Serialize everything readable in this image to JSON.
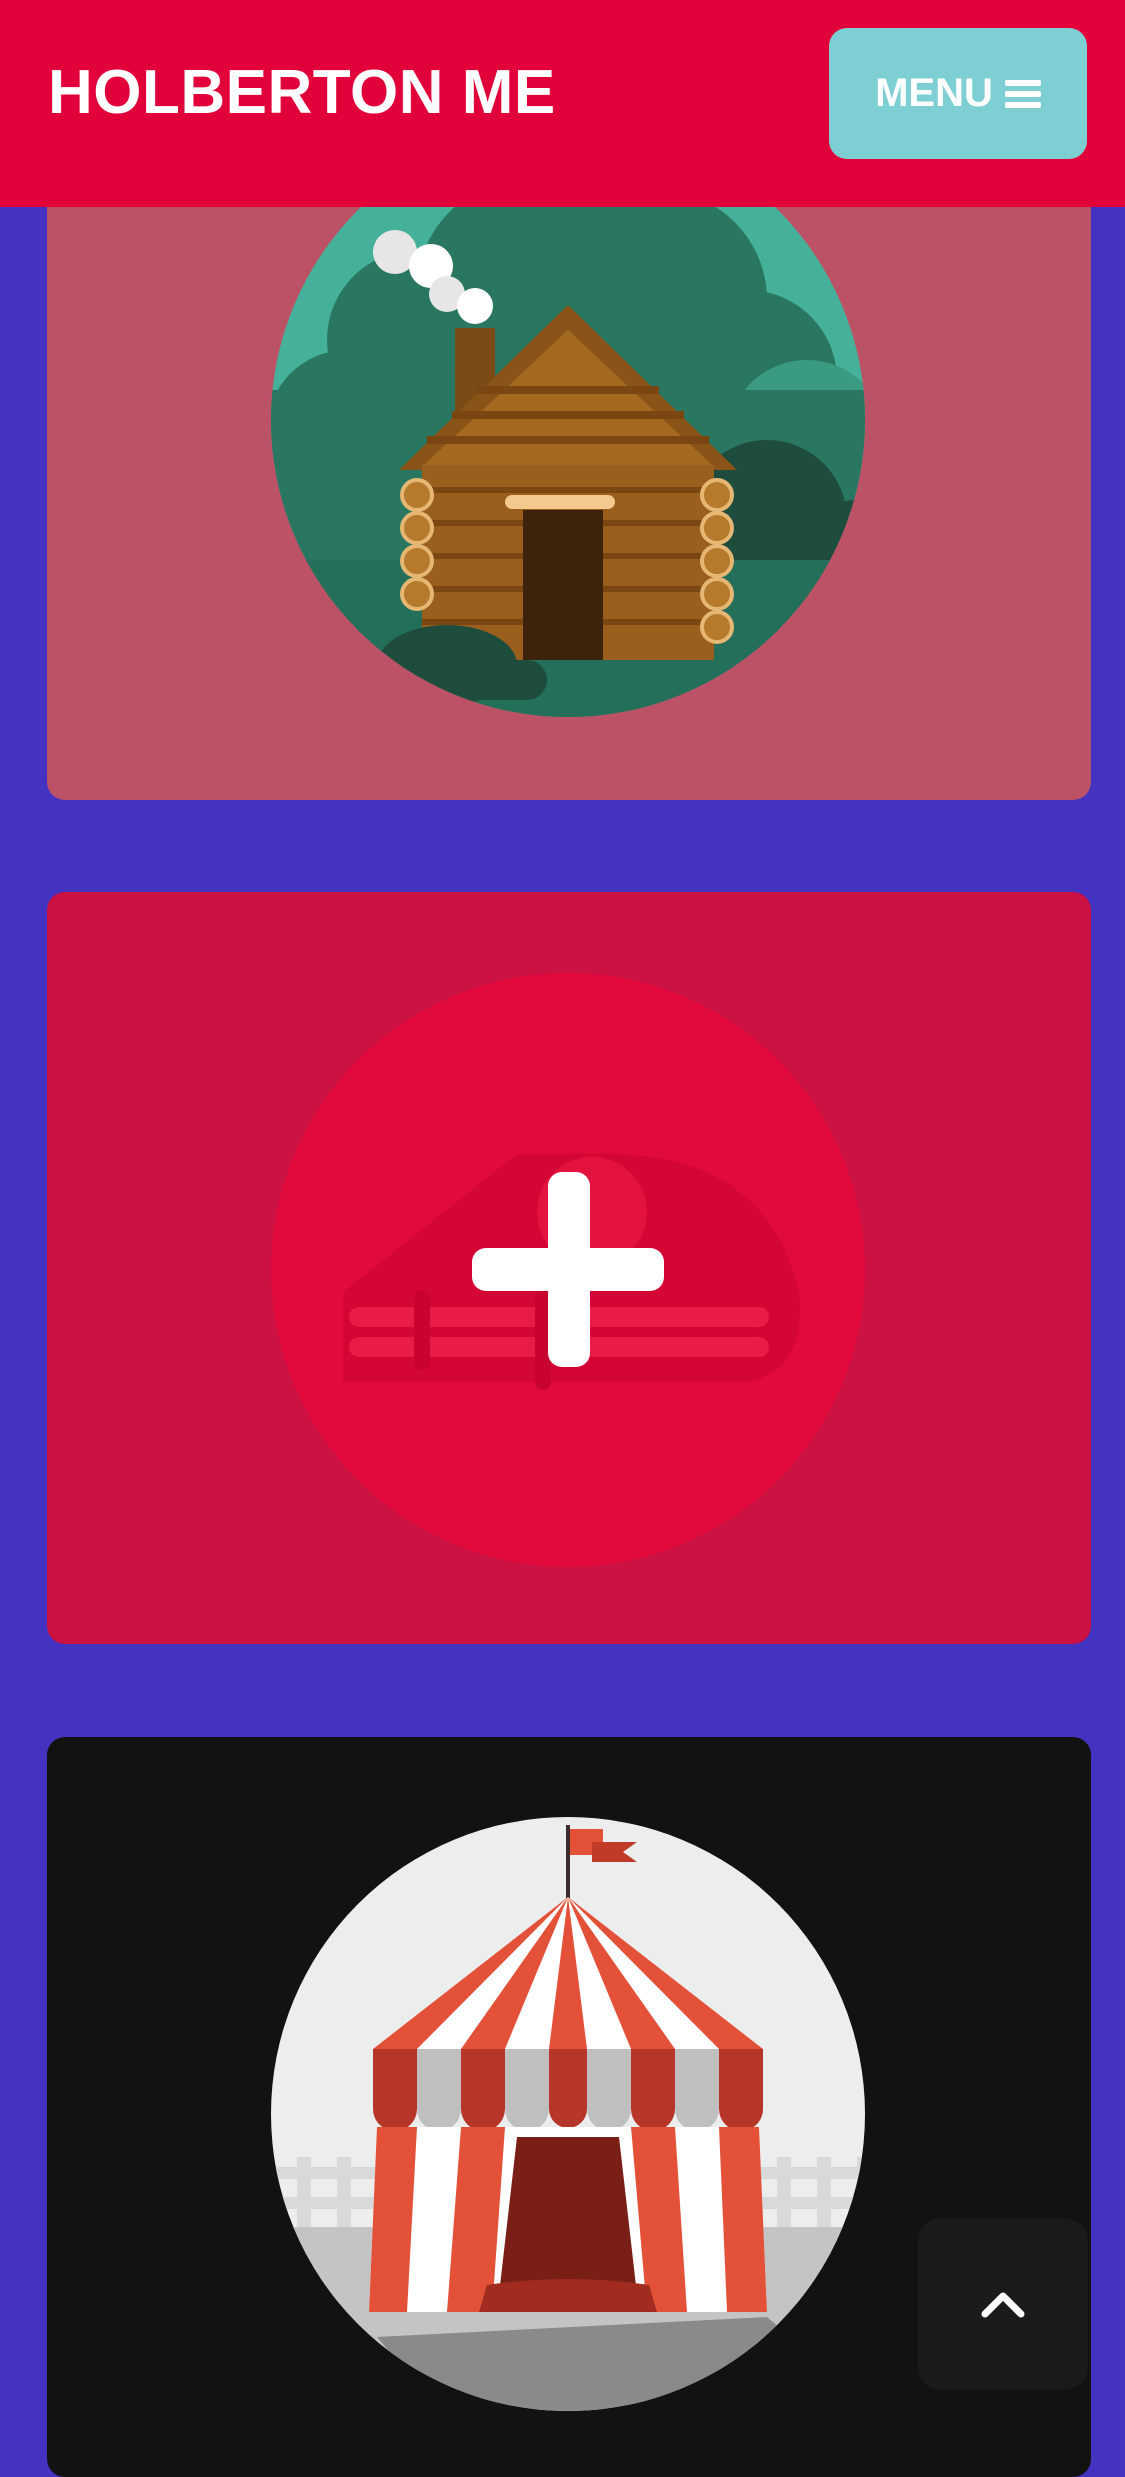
{
  "header": {
    "brand": "HOLBERTON ME",
    "menu_label": "MENU",
    "background": "#e2003a",
    "menu_color": "#7ecfd3"
  },
  "cards": [
    {
      "name": "log-cabin",
      "background": "#bb5266"
    },
    {
      "name": "add-project",
      "background": "#cc1143",
      "icon": "plus-icon"
    },
    {
      "name": "circus-tent",
      "background": "#141111"
    }
  ],
  "back_to_top": {
    "icon": "chevron-up-icon"
  },
  "page_background": "#4333c0"
}
